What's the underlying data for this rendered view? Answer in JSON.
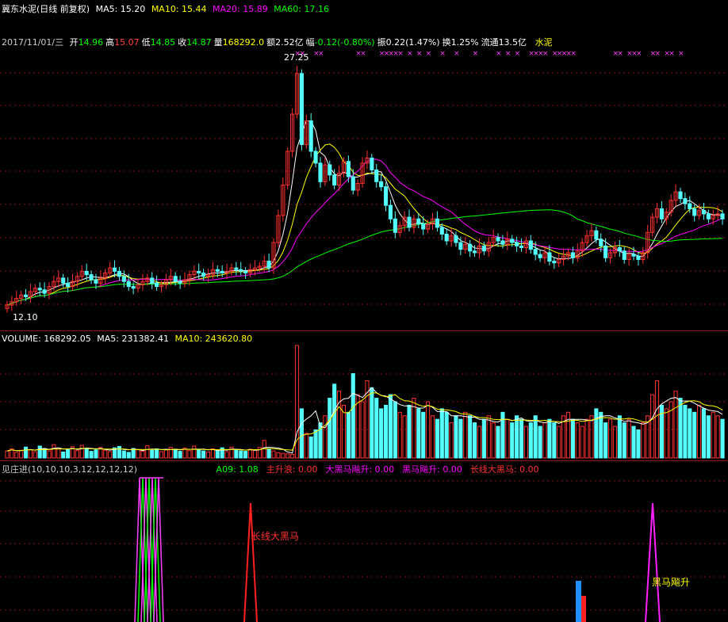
{
  "header": {
    "title": "冀东水泥(日线 前复权)",
    "ma": [
      {
        "label": "MA5: 15.20",
        "color": "#ffffff"
      },
      {
        "label": "MA10: 15.44",
        "color": "#ffff00"
      },
      {
        "label": "MA20: 15.89",
        "color": "#ff00ff"
      },
      {
        "label": "MA60: 17.16",
        "color": "#00ff00"
      }
    ]
  },
  "info_bar": {
    "date": "2017/11/01/三",
    "items": [
      {
        "label": "开",
        "value": "14.96",
        "color": "#00ff00"
      },
      {
        "label": "高",
        "value": "15.07",
        "color": "#ff4040"
      },
      {
        "label": "低",
        "value": "14.85",
        "color": "#00ff00"
      },
      {
        "label": "收",
        "value": "14.87",
        "color": "#00ff00"
      },
      {
        "label": "量",
        "value": "168292.0",
        "color": "#ffff00"
      },
      {
        "label": "额",
        "value": "2.52亿",
        "color": "#ffffff"
      },
      {
        "label": "幅",
        "value": "-0.12(-0.80%)",
        "color": "#00ff00"
      },
      {
        "label": "振",
        "value": "0.22(1.47%)",
        "color": "#ffffff"
      },
      {
        "label": "换",
        "value": "1.25%",
        "color": "#ffffff"
      },
      {
        "label": "流通",
        "value": "13.5亿",
        "color": "#ffffff"
      }
    ],
    "sector": "水泥"
  },
  "price_labels": {
    "high": "27.25",
    "low": "12.10"
  },
  "volume_header": {
    "title": "VOLUME: 168292.05",
    "ma5": "MA5: 231382.41",
    "ma10": "MA10: 243620.80"
  },
  "indicator_header": {
    "title": "见庄进(10,10,10,3,12,12,12,12)",
    "items": [
      {
        "label": "A09: 1.08",
        "color": "#00ff00"
      },
      {
        "label": "主升浪: 0.00",
        "color": "#ff3030"
      },
      {
        "label": "大黑马飚升: 0.00",
        "color": "#ff00ff"
      },
      {
        "label": "黑马飚升: 0.00",
        "color": "#ff00ff"
      },
      {
        "label": "长线大黑马: 0.00",
        "color": "#ff3030"
      }
    ]
  },
  "indicator_labels": {
    "long_horse": "长线大黑马",
    "horse_rise": "黑马飚升"
  },
  "chart_data": {
    "type": "candlestick",
    "price_range": [
      12.1,
      27.25
    ],
    "closes": [
      12.5,
      12.7,
      12.9,
      13.1,
      13.0,
      13.3,
      13.5,
      13.4,
      13.2,
      13.6,
      13.9,
      14.1,
      13.8,
      13.6,
      13.9,
      14.2,
      14.5,
      14.3,
      14.0,
      13.8,
      14.1,
      14.4,
      14.7,
      14.5,
      14.2,
      13.9,
      13.6,
      13.5,
      13.7,
      13.9,
      14.1,
      13.8,
      13.6,
      13.7,
      14.0,
      14.2,
      13.9,
      13.8,
      14.0,
      14.3,
      14.5,
      14.4,
      14.2,
      14.3,
      14.6,
      14.5,
      14.4,
      14.5,
      14.7,
      14.6,
      14.5,
      14.4,
      14.6,
      14.7,
      14.8,
      15.1,
      14.7,
      16.2,
      17.8,
      19.6,
      21.6,
      23.8,
      26.2,
      22.0,
      23.4,
      21.6,
      20.9,
      19.8,
      20.8,
      20.2,
      19.6,
      20.3,
      21.0,
      20.1,
      19.3,
      19.7,
      20.9,
      21.2,
      20.5,
      19.8,
      19.5,
      18.4,
      17.6,
      16.8,
      17.2,
      17.7,
      17.1,
      17.6,
      17.3,
      17.0,
      17.3,
      17.6,
      17.1,
      16.7,
      16.3,
      16.6,
      16.2,
      15.8,
      16.1,
      15.7,
      15.6,
      16.0,
      15.7,
      16.2,
      16.5,
      16.3,
      16.1,
      16.4,
      16.2,
      16.0,
      15.9,
      16.3,
      15.8,
      15.5,
      15.3,
      15.6,
      15.1,
      15.0,
      15.2,
      15.4,
      15.6,
      15.3,
      15.7,
      16.2,
      16.6,
      16.9,
      16.4,
      16.0,
      15.3,
      15.6,
      15.9,
      15.7,
      15.2,
      15.5,
      15.4,
      15.2,
      15.6,
      16.8,
      17.7,
      18.2,
      17.6,
      18.0,
      18.7,
      19.2,
      18.8,
      18.5,
      18.2,
      17.8,
      18.1,
      17.9,
      17.6,
      17.8,
      17.9,
      17.6
    ],
    "volumes": [
      2.0,
      2.6,
      1.6,
      2.2,
      3.1,
      2.4,
      1.8,
      3.4,
      2.7,
      2.0,
      3.8,
      2.6,
      1.7,
      2.5,
      3.2,
      2.1,
      3.6,
      2.8,
      1.9,
      2.3,
      3.0,
      2.2,
      1.8,
      2.9,
      3.3,
      2.0,
      1.6,
      2.7,
      2.4,
      1.9,
      3.5,
      2.2,
      2.6,
      1.8,
      2.3,
      3.0,
      2.5,
      1.9,
      2.8,
      2.1,
      3.4,
      2.3,
      2.0,
      1.7,
      2.6,
      2.2,
      2.9,
      1.8,
      3.1,
      2.4,
      2.0,
      1.9,
      2.5,
      2.2,
      3.0,
      5.0,
      2.6,
      2.0,
      1.5,
      1.3,
      1.2,
      1.0,
      32.0,
      14.0,
      7.0,
      6.0,
      8.0,
      10.0,
      12.0,
      17.0,
      21.0,
      19.0,
      15.0,
      13.0,
      24.0,
      18.0,
      16.0,
      22.0,
      20.0,
      17.0,
      14.0,
      15.0,
      18.0,
      16.0,
      13.0,
      12.0,
      15.0,
      17.0,
      14.0,
      13.0,
      16.0,
      12.0,
      11.0,
      14.0,
      13.0,
      10.0,
      12.0,
      11.0,
      13.0,
      12.0,
      10.0,
      9.0,
      11.0,
      12.0,
      10.0,
      9.0,
      13.0,
      11.0,
      10.0,
      12.0,
      11.0,
      9.0,
      10.0,
      12.0,
      9.0,
      10.0,
      11.0,
      10.0,
      9.0,
      12.0,
      13.0,
      11.0,
      10.0,
      9.0,
      11.0,
      12.0,
      14.0,
      13.0,
      10.0,
      11.0,
      9.0,
      12.0,
      10.0,
      11.0,
      9.0,
      8.0,
      10.0,
      12.0,
      18.0,
      22.0,
      15.0,
      14.0,
      16.0,
      19.0,
      17.0,
      15.0,
      14.0,
      13.0,
      15.0,
      14.0,
      12.0,
      13.0,
      12.0,
      11.0
    ]
  }
}
